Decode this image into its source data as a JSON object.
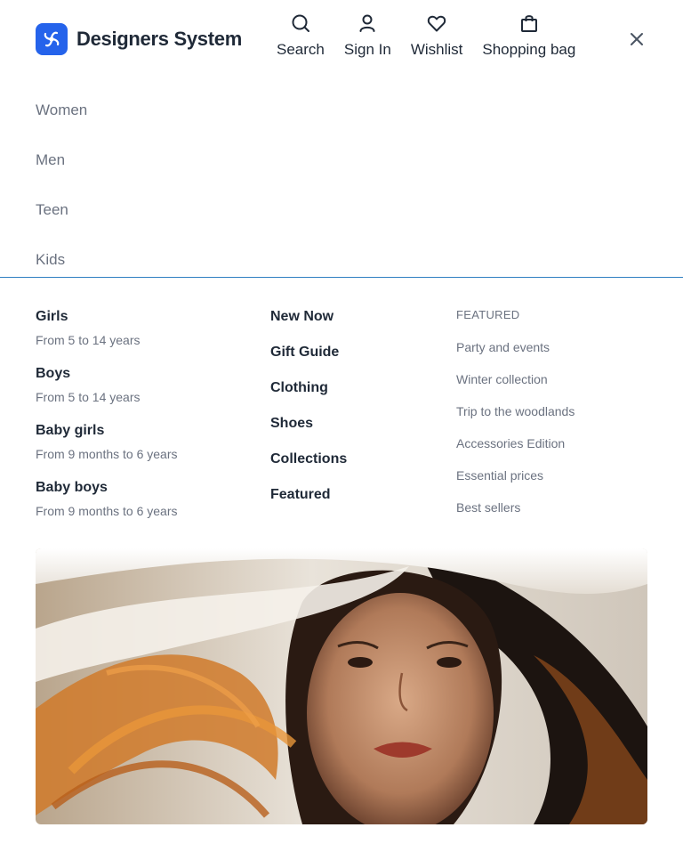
{
  "brand": {
    "name": "Designers System",
    "color": "#2563eb"
  },
  "header": {
    "actions": [
      {
        "label": "Search",
        "icon": "search-icon"
      },
      {
        "label": "Sign In",
        "icon": "user-icon"
      },
      {
        "label": "Wishlist",
        "icon": "heart-icon"
      },
      {
        "label": "Shopping bag",
        "icon": "bag-icon"
      }
    ],
    "close_icon": "close-icon"
  },
  "main_menu": [
    "Women",
    "Men",
    "Teen",
    "Kids"
  ],
  "age_groups": [
    {
      "title": "Girls",
      "subtitle": "From 5 to 14 years"
    },
    {
      "title": "Boys",
      "subtitle": "From 5 to 14 years"
    },
    {
      "title": "Baby girls",
      "subtitle": "From 9 months to 6 years"
    },
    {
      "title": "Baby boys",
      "subtitle": "From 9 months to 6 years"
    }
  ],
  "categories": [
    "New Now",
    "Gift Guide",
    "Clothing",
    "Shoes",
    "Collections",
    "Featured"
  ],
  "featured": {
    "heading": "FEATURED",
    "items": [
      "Party and events",
      "Winter collection",
      "Trip to the woodlands",
      "Accessories Edition",
      "Essential prices",
      "Best sellers"
    ]
  },
  "colors": {
    "accent_divider": "#2f7fc1",
    "text_primary": "#1f2937",
    "text_muted": "#6b7280"
  }
}
